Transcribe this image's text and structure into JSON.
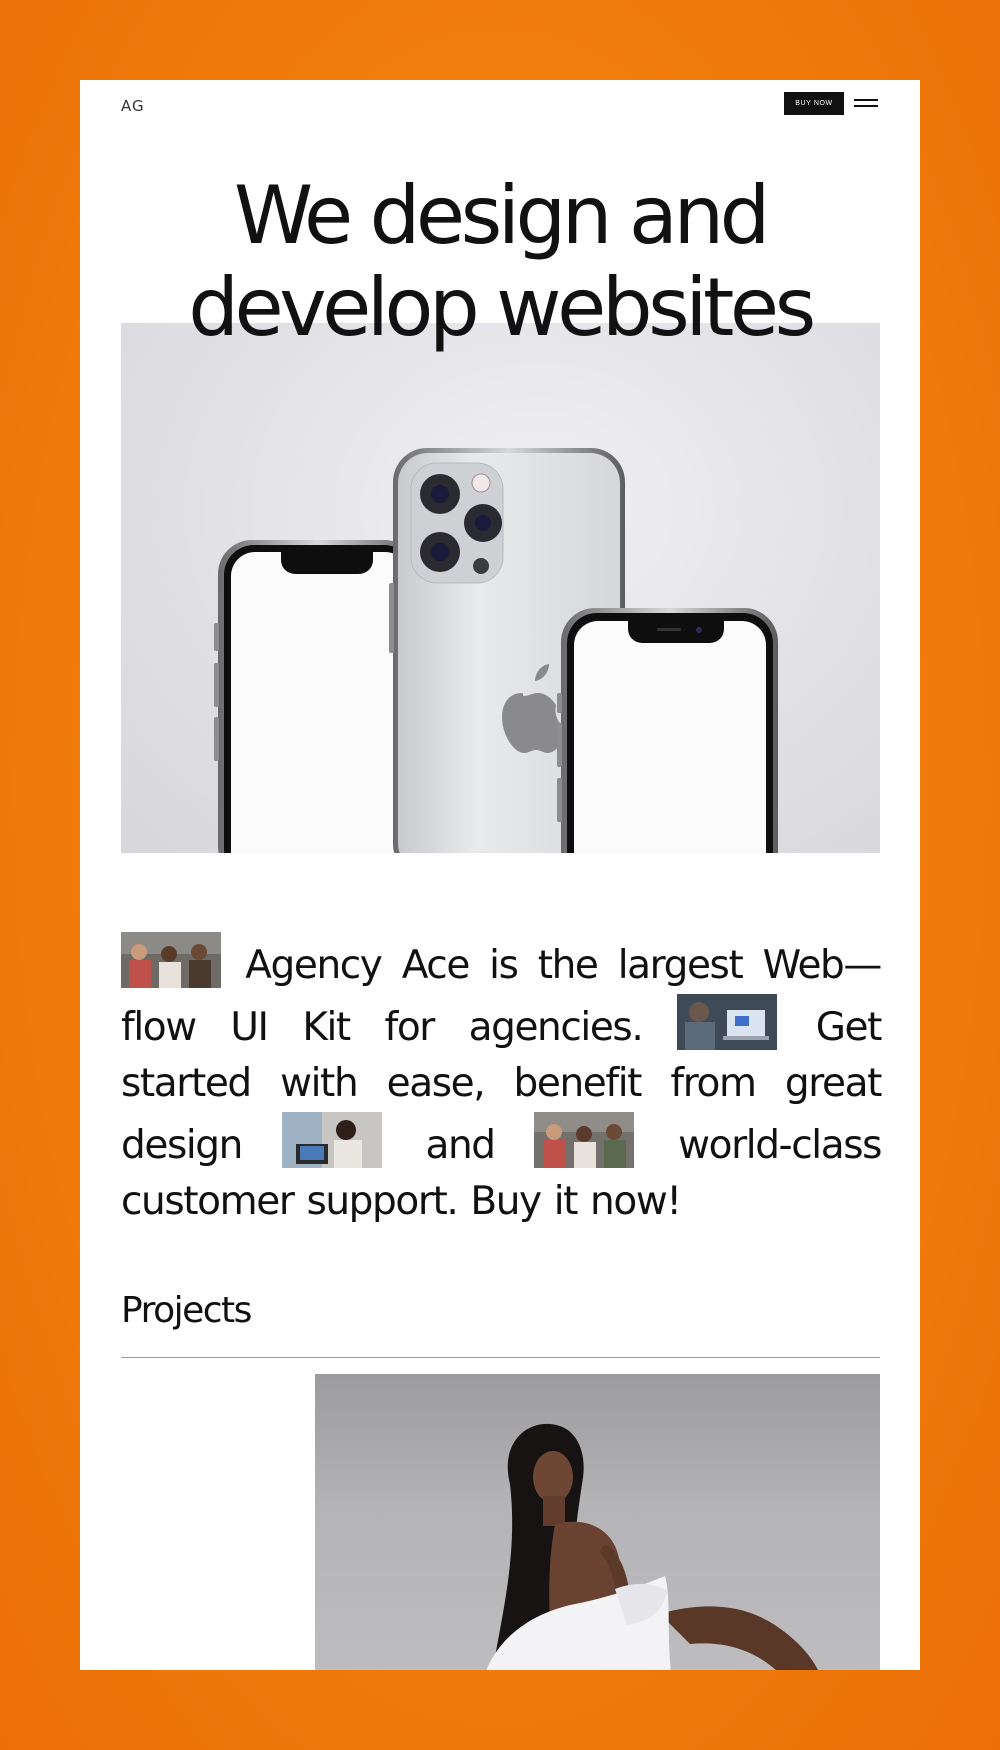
{
  "header": {
    "logo": "AG",
    "buy_label": "BUY NOW",
    "menu_icon": "hamburger-icon"
  },
  "hero": {
    "title_line1": "We design and",
    "title_line2": "develop websites",
    "image": "three silver smartphones"
  },
  "about": {
    "text_1": "Agency Ace is the largest Web—flow UI Kit for agencies.",
    "text_2": "Get started with ease, benefit from great design",
    "text_3": "and",
    "text_4": "world-class customer support. Buy it now!"
  },
  "projects": {
    "title": "Projects"
  },
  "colors": {
    "accent": "#f2800f",
    "text": "#111111",
    "button_bg": "#111111"
  }
}
